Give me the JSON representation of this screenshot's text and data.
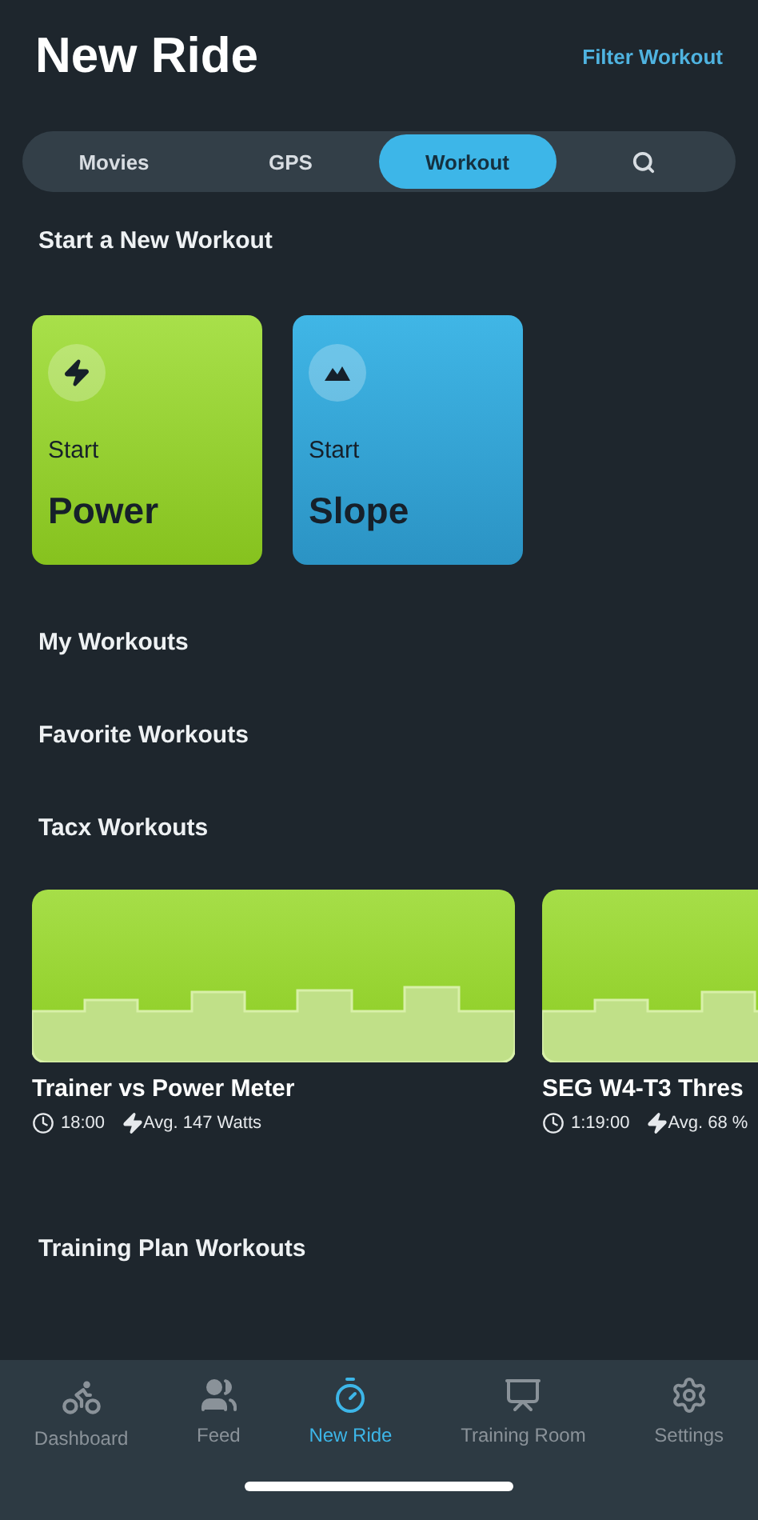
{
  "header": {
    "title": "New Ride",
    "action": "Filter Workout"
  },
  "tabs": [
    {
      "kind": "text",
      "label": "Movies",
      "selected": false
    },
    {
      "kind": "text",
      "label": "GPS",
      "selected": false
    },
    {
      "kind": "text",
      "label": "Workout",
      "selected": true
    },
    {
      "kind": "search",
      "selected": false
    }
  ],
  "start_section": {
    "title": "Start a New Workout",
    "cards": [
      {
        "kind": "power",
        "caption": "Start",
        "label": "Power"
      },
      {
        "kind": "slope",
        "caption": "Start",
        "label": "Slope"
      }
    ]
  },
  "sections": [
    "My Workouts",
    "Favorite Workouts",
    "Tacx Workouts"
  ],
  "workouts": [
    {
      "title": "Trainer vs Power Meter",
      "duration": "18:00",
      "average": "Avg. 147 Watts"
    },
    {
      "title": "SEG W4-T3 Thres",
      "duration": "1:19:00",
      "average": "Avg. 68 %"
    }
  ],
  "footer_section": "Training Plan Workouts",
  "nav": [
    {
      "kind": "dashboard",
      "label": "Dashboard",
      "selected": false
    },
    {
      "kind": "feed",
      "label": "Feed",
      "selected": false
    },
    {
      "kind": "ride",
      "label": "New Ride",
      "selected": true
    },
    {
      "kind": "training",
      "label": "Training Room",
      "selected": false
    },
    {
      "kind": "settings",
      "label": "Settings",
      "selected": false
    }
  ]
}
